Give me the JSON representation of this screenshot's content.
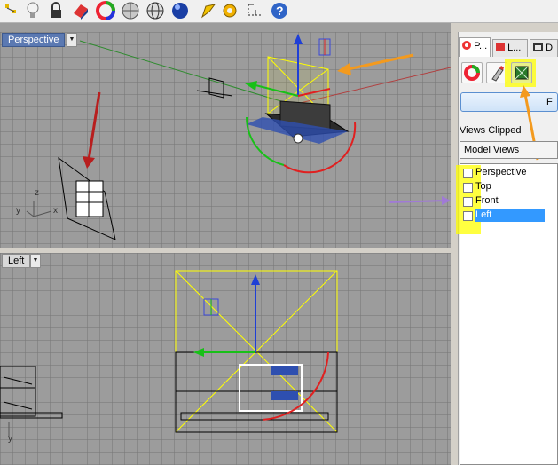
{
  "viewports": {
    "perspective": {
      "label": "Perspective"
    },
    "left": {
      "label": "Left"
    },
    "persp_axes": {
      "x": "x",
      "y": "y",
      "z": "z"
    },
    "left_axes": {
      "y": "y"
    }
  },
  "panel": {
    "tabs": [
      "P...",
      "L...",
      "D"
    ],
    "wide_button_label": "F",
    "views_clipped_label": "Views Clipped",
    "select_value": "Model Views",
    "views": [
      {
        "label": "Perspective",
        "checked": false,
        "selected": false
      },
      {
        "label": "Top",
        "checked": false,
        "selected": false
      },
      {
        "label": "Front",
        "checked": false,
        "selected": false
      },
      {
        "label": "Left",
        "checked": false,
        "selected": true
      }
    ]
  },
  "toolbar": {
    "icons": [
      "point-icon",
      "lightbulb-icon",
      "lock-icon",
      "render-icon",
      "color-wheel-icon",
      "sphere-icon",
      "wire-sphere-icon",
      "shaded-sphere-icon",
      "pencil-icon",
      "gear-icon",
      "dimension-icon",
      "help-icon"
    ]
  },
  "annotations": {
    "colors": {
      "red_arrow": "#b81e1e",
      "orange_arrow": "#f39a1e",
      "purple_arrow": "#a07ad6",
      "highlight": "#ffff00"
    }
  }
}
